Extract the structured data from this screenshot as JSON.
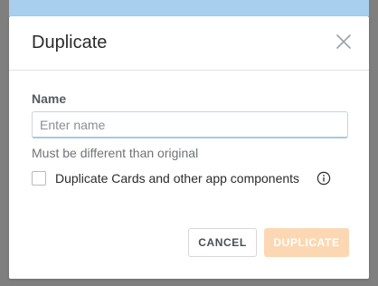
{
  "dialog": {
    "title": "Duplicate",
    "close_icon": "close-icon",
    "name_field": {
      "label": "Name",
      "value": "",
      "placeholder": "Enter name",
      "hint": "Must be different than original"
    },
    "option": {
      "label": "Duplicate Cards and other app components",
      "checked": false,
      "info_icon": "info-icon"
    },
    "buttons": {
      "cancel_label": "CANCEL",
      "duplicate_label": "DUPLICATE",
      "duplicate_disabled": true
    }
  },
  "colors": {
    "primary_disabled": "#fcd7b3",
    "top_accent": "#a9cfee",
    "overlay": "#7f7f7f"
  }
}
